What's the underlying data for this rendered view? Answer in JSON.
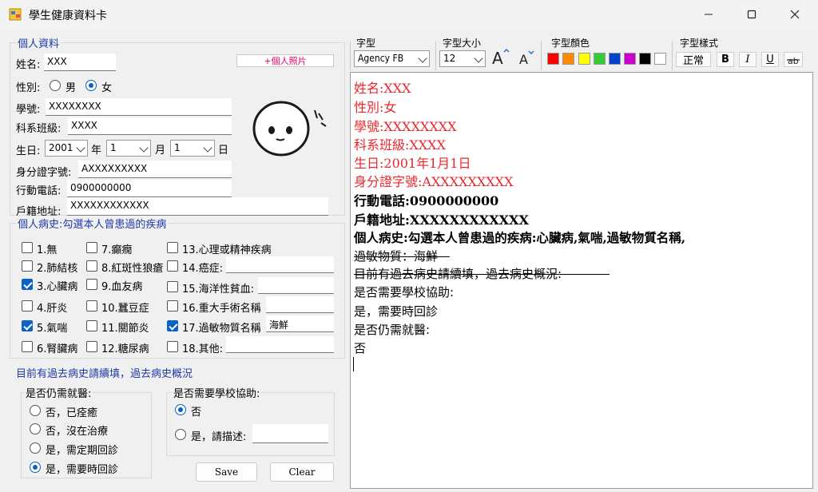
{
  "window": {
    "title": "學生健康資料卡",
    "minimize_icon": "minimize-icon",
    "maximize_icon": "maximize-icon",
    "close_icon": "close-icon"
  },
  "personal": {
    "legend": "個人資料",
    "name_label": "姓名:",
    "name_value": "XXX",
    "gender_label": "性別:",
    "male_label": "男",
    "female_label": "女",
    "gender_selected": "女",
    "student_id_label": "學號:",
    "student_id_value": "XXXXXXXX",
    "class_label": "科系班級:",
    "class_value": "XXXX",
    "birth_label": "生日:",
    "birth_year": "2001",
    "year_suffix": "年",
    "birth_month": "1",
    "month_suffix": "月",
    "birth_day": "1",
    "day_suffix": "日",
    "id_label": "身分證字號:",
    "id_value": "AXXXXXXXXX",
    "phone_label": "行動電話:",
    "phone_value": "0900000000",
    "address_label": "戶籍地址:",
    "address_value": "XXXXXXXXXXXX",
    "photo_button": "+個人照片"
  },
  "history": {
    "legend": "個人病史:勾選本人曾患過的疾病",
    "items": [
      {
        "label": "1.無",
        "checked": false
      },
      {
        "label": "2.肺結核",
        "checked": false
      },
      {
        "label": "3.心臟病",
        "checked": true
      },
      {
        "label": "4.肝炎",
        "checked": false
      },
      {
        "label": "5.氣喘",
        "checked": true
      },
      {
        "label": "6.腎臟病",
        "checked": false
      },
      {
        "label": "7.癲癇",
        "checked": false
      },
      {
        "label": "8.紅斑性狼瘡",
        "checked": false
      },
      {
        "label": "9.血友病",
        "checked": false
      },
      {
        "label": "10.蠶豆症",
        "checked": false
      },
      {
        "label": "11.關節炎",
        "checked": false
      },
      {
        "label": "12.糖尿病",
        "checked": false
      },
      {
        "label": "13.心理或精神疾病",
        "checked": false
      },
      {
        "label": "14.癌症:",
        "checked": false
      },
      {
        "label": "15.海洋性貧血:",
        "checked": false
      },
      {
        "label": "16.重大手術名稱",
        "checked": false
      },
      {
        "label": "17.過敏物質名稱",
        "checked": true
      },
      {
        "label": "18.其他:",
        "checked": false
      }
    ],
    "allergy_value": "海鮮",
    "past_note": "目前有過去病史請續填，過去病史概況"
  },
  "treatment": {
    "legend": "是否仍需就醫:",
    "options": [
      "否，已痊癒",
      "否，沒在治療",
      "是，需定期回診",
      "是，需要時回診"
    ],
    "selected_index": 3
  },
  "assist": {
    "legend": "是否需要學校協助:",
    "no_label": "否",
    "yes_label": "是，請描述:",
    "selected": "否"
  },
  "buttons": {
    "save": "Save",
    "clear": "Clear"
  },
  "toolbar": {
    "font_label": "字型",
    "font_value": "Agency FB",
    "size_label": "字型大小",
    "size_value": "12",
    "grow_icon": "font-grow-icon",
    "shrink_icon": "font-shrink-icon",
    "color_label": "字型顏色",
    "colors": [
      "#ff0000",
      "#ff8c00",
      "#ffff00",
      "#33cc33",
      "#0044cc",
      "#cc00cc",
      "#000000",
      "#ffffff"
    ],
    "style_label": "字型樣式",
    "style_regular": "正常",
    "style_bold": "B",
    "style_italic": "I",
    "style_underline": "U",
    "style_strike": "abc-strike"
  },
  "editor": {
    "lines": [
      {
        "text": "姓名:XXX",
        "style": "red"
      },
      {
        "text": "性別:女",
        "style": "red"
      },
      {
        "text": "學號:XXXXXXXX",
        "style": "red"
      },
      {
        "text": "科系班級:XXXX",
        "style": "red"
      },
      {
        "text": "生日:2001年1月1日",
        "style": "red"
      },
      {
        "text": "身分證字號:AXXXXXXXXX",
        "style": "red"
      },
      {
        "text": "行動電話:0900000000",
        "style": "bold"
      },
      {
        "text": "戶籍地址:XXXXXXXXXXXX",
        "style": "bold"
      },
      {
        "text": "個人病史:勾選本人曾患過的疾病:心臟病,氣喘,過敏物質名稱,",
        "style": "bold"
      },
      {
        "text": "過敏物質：海鮮",
        "style": "strike"
      },
      {
        "text": "目前有過去病史請續填，過去病史概況:",
        "style": "strike"
      },
      {
        "text": "是否需要學校協助:",
        "style": "normal"
      },
      {
        "text": "是，需要時回診",
        "style": "normal"
      },
      {
        "text": "是否仍需就醫:",
        "style": "normal"
      },
      {
        "text": "否",
        "style": "normal"
      }
    ]
  }
}
